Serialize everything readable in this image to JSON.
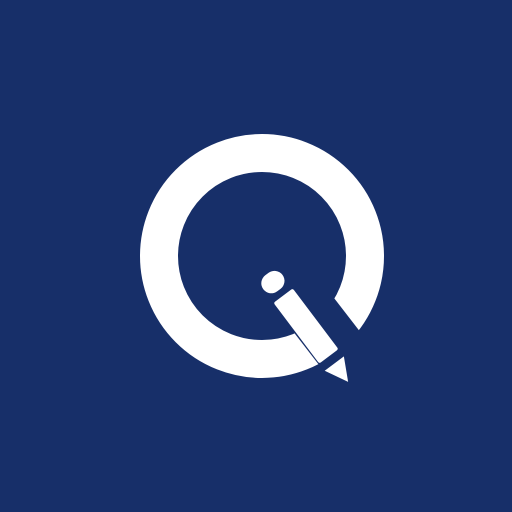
{
  "app_icon": {
    "icon": "q-pencil-logo-icon",
    "colors": {
      "background": "#172f69",
      "foreground": "#ffffff"
    }
  }
}
